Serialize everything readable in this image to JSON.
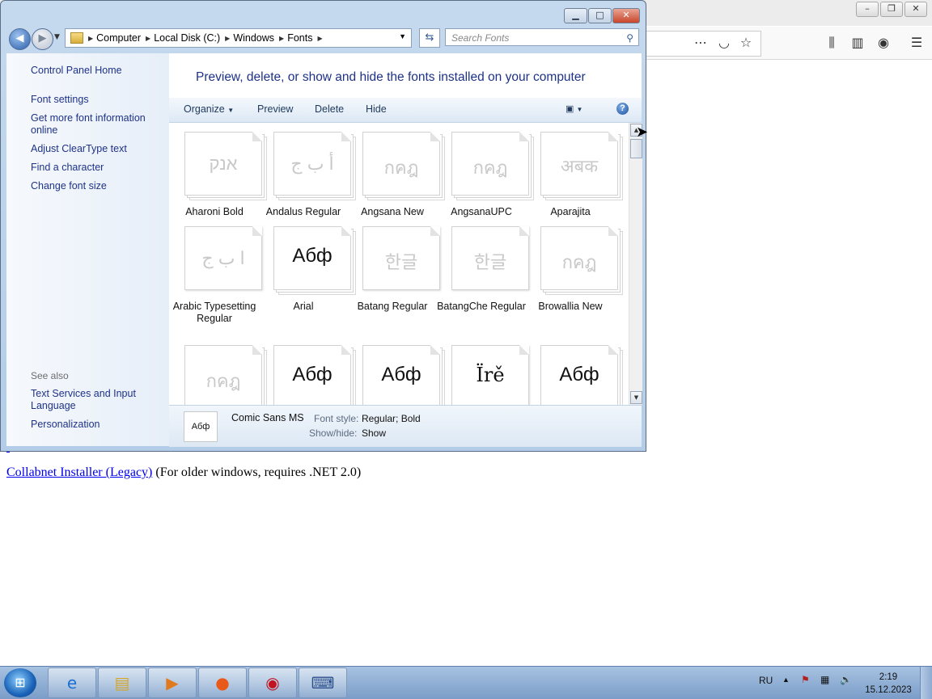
{
  "window": {
    "buttons": {
      "minimize": "▭",
      "maximize": "□",
      "close": "✕"
    },
    "address": [
      "Computer",
      "Local Disk (C:)",
      "Windows",
      "Fonts"
    ],
    "search_placeholder": "Search Fonts"
  },
  "left_pane": {
    "items": [
      "Control Panel Home",
      "Font settings",
      "Get more font information online",
      "Adjust ClearType text",
      "Find a character",
      "Change font size"
    ],
    "see_also_title": "See also",
    "see_also": [
      "Text Services and Input Language",
      "Personalization"
    ]
  },
  "content": {
    "heading": "Preview, delete, or show and hide the fonts installed on your computer",
    "commands": {
      "organize": "Organize",
      "preview": "Preview",
      "delete": "Delete",
      "hide": "Hide",
      "help": "?"
    },
    "fonts": [
      {
        "name": "Aharoni Bold",
        "sample": "אנק"
      },
      {
        "name": "Andalus Regular",
        "sample": "أ ب ج"
      },
      {
        "name": "Angsana New",
        "sample": "กคฎ"
      },
      {
        "name": "AngsanaUPC",
        "sample": "กคฎ"
      },
      {
        "name": "Aparajita",
        "sample": "अबक"
      },
      {
        "name": "Arabic Typesetting Regular",
        "sample": "ا ب ج"
      },
      {
        "name": "Arial",
        "sample": "Абф"
      },
      {
        "name": "Batang Regular",
        "sample": "한글"
      },
      {
        "name": "BatangChe Regular",
        "sample": "한글"
      },
      {
        "name": "Browallia New",
        "sample": "กคฎ"
      },
      {
        "name": "",
        "sample": "กคฎ"
      },
      {
        "name": "",
        "sample": "Абф"
      },
      {
        "name": "",
        "sample": "Абф"
      },
      {
        "name": "",
        "sample": "Ïrě"
      },
      {
        "name": "",
        "sample": "Абф"
      }
    ],
    "details": {
      "icon_sample": "Абф",
      "name": "Comic Sans MS",
      "font_style_label": "Font style:",
      "font_style_value": "Regular; Bold",
      "show_hide_label": "Show/hide:",
      "show_hide_value": "Show"
    }
  },
  "browser_page": {
    "link_text": "Collabnet Installer (Legacy)",
    "trailing_text": " (For older windows, requires .NET 2.0)"
  },
  "taskbar": {
    "language": "RU",
    "time": "2:19",
    "date": "15.12.2023"
  }
}
